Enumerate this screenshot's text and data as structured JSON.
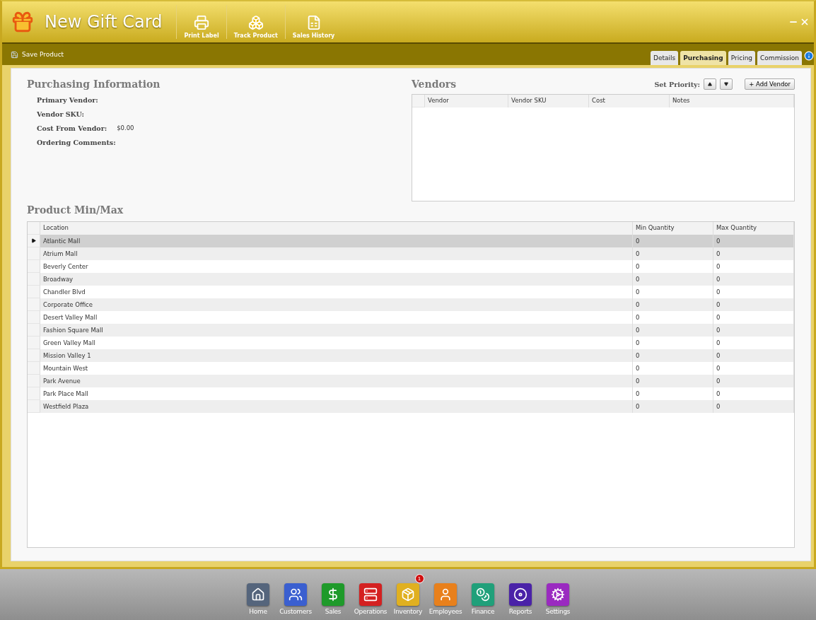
{
  "window": {
    "title": "New Gift Card"
  },
  "toolbar": [
    {
      "label": "Print Label",
      "kind": "printer"
    },
    {
      "label": "Track Product",
      "kind": "boxes"
    },
    {
      "label": "Sales History",
      "kind": "sheet"
    }
  ],
  "action_bar": {
    "save": "Save Product",
    "tabs": [
      {
        "label": "Details",
        "selected": false
      },
      {
        "label": "Purchasing",
        "selected": true
      },
      {
        "label": "Pricing",
        "selected": false
      },
      {
        "label": "Commission",
        "selected": false
      }
    ]
  },
  "purchasing_info": {
    "title": "Purchasing Information",
    "fields": [
      {
        "label": "Primary Vendor:"
      },
      {
        "label": "Vendor SKU:"
      },
      {
        "label": "Cost From Vendor:",
        "value": "$0.00"
      },
      {
        "label": "Ordering Comments:"
      }
    ]
  },
  "vendors": {
    "title": "Vendors",
    "priority_label": "Set Priority:",
    "add_button": "+ Add Vendor",
    "columns": [
      "Vendor",
      "Vendor SKU",
      "Cost",
      "Notes"
    ]
  },
  "min_max": {
    "title": "Product Min/Max",
    "columns": [
      "Location",
      "Min Quantity",
      "Max Quantity"
    ],
    "rows": [
      {
        "location": "Atlantic Mall",
        "min": "0",
        "max": "0",
        "selected": true
      },
      {
        "location": "Atrium Mall",
        "min": "0",
        "max": "0",
        "selected": false
      },
      {
        "location": "Beverly Center",
        "min": "0",
        "max": "0",
        "selected": false
      },
      {
        "location": "Broadway",
        "min": "0",
        "max": "0",
        "selected": false
      },
      {
        "location": "Chandler Blvd",
        "min": "0",
        "max": "0",
        "selected": false
      },
      {
        "location": "Corporate Office",
        "min": "0",
        "max": "0",
        "selected": false
      },
      {
        "location": "Desert Valley Mall",
        "min": "0",
        "max": "0",
        "selected": false
      },
      {
        "location": "Fashion Square Mall",
        "min": "0",
        "max": "0",
        "selected": false
      },
      {
        "location": "Green Valley Mall",
        "min": "0",
        "max": "0",
        "selected": false
      },
      {
        "location": "Mission Valley 1",
        "min": "0",
        "max": "0",
        "selected": false
      },
      {
        "location": "Mountain West",
        "min": "0",
        "max": "0",
        "selected": false
      },
      {
        "location": "Park Avenue",
        "min": "0",
        "max": "0",
        "selected": false
      },
      {
        "location": "Park Place Mall",
        "min": "0",
        "max": "0",
        "selected": false
      },
      {
        "location": "Westfield Plaza",
        "min": "0",
        "max": "0",
        "selected": false
      }
    ]
  },
  "dock": [
    {
      "label": "Home",
      "kind": "home",
      "color": "#55657c"
    },
    {
      "label": "Customers",
      "kind": "users",
      "color": "#3a5fd0"
    },
    {
      "label": "Sales",
      "kind": "dollar",
      "color": "#1e9a2a"
    },
    {
      "label": "Operations",
      "kind": "server",
      "color": "#d42020"
    },
    {
      "label": "Inventory",
      "kind": "package",
      "color": "#e0b020",
      "badge": "1"
    },
    {
      "label": "Employees",
      "kind": "user",
      "color": "#e8801c"
    },
    {
      "label": "Finance",
      "kind": "coins",
      "color": "#20a07a"
    },
    {
      "label": "Reports",
      "kind": "disc",
      "color": "#4a22a8"
    },
    {
      "label": "Settings",
      "kind": "cog",
      "color": "#9a2ac0"
    }
  ]
}
